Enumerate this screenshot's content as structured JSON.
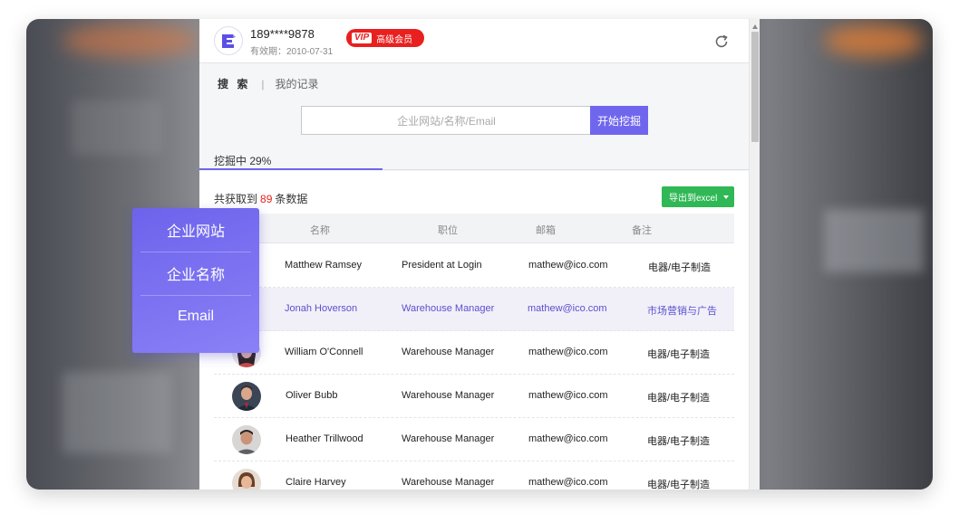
{
  "account": {
    "phone": "189****9878",
    "validity": "有效期：2010-07-31",
    "vip_tag": "VIP",
    "vip_label": "高级会员"
  },
  "nav": {
    "search_tab": "搜 索",
    "separator": "|",
    "records_tab": "我的记录"
  },
  "search": {
    "placeholder": "企业网站/名称/Email",
    "button_label": "开始挖掘"
  },
  "progress": {
    "label": "挖掘中 29%",
    "percent": 29
  },
  "results": {
    "count_prefix": "共获取到",
    "count": "89",
    "count_suffix": "条数据",
    "export_label": "导出到excel"
  },
  "table": {
    "headers": [
      "名称",
      "职位",
      "邮箱",
      "备注"
    ],
    "rows": [
      {
        "name": "Matthew Ramsey",
        "position": "President at Login",
        "email": "mathew@ico.com",
        "note": "电器/电子制造",
        "avatar": "none"
      },
      {
        "name": "Jonah Hoverson",
        "position": "Warehouse Manager",
        "email": "mathew@ico.com",
        "note": "市场营销与广告",
        "avatar": "none"
      },
      {
        "name": "William O'Connell",
        "position": "Warehouse Manager",
        "email": "mathew@ico.com",
        "note": "电器/电子制造",
        "avatar": "female-dark-hair"
      },
      {
        "name": "Oliver Bubb",
        "position": "Warehouse Manager",
        "email": "mathew@ico.com",
        "note": "电器/电子制造",
        "avatar": "male-suit"
      },
      {
        "name": "Heather Trillwood",
        "position": "Warehouse Manager",
        "email": "mathew@ico.com",
        "note": "电器/电子制造",
        "avatar": "male-casual"
      },
      {
        "name": "Claire Harvey",
        "position": "Warehouse Manager",
        "email": "mathew@ico.com",
        "note": "电器/电子制造",
        "avatar": "female-brown-hair"
      }
    ]
  },
  "search_type_menu": {
    "items": [
      "企业网站",
      "企业名称",
      "Email"
    ]
  },
  "colors": {
    "accent": "#7066ee",
    "vip_red": "#e8201f",
    "export_green": "#2fb855",
    "highlight_text": "#5a4fcf"
  }
}
